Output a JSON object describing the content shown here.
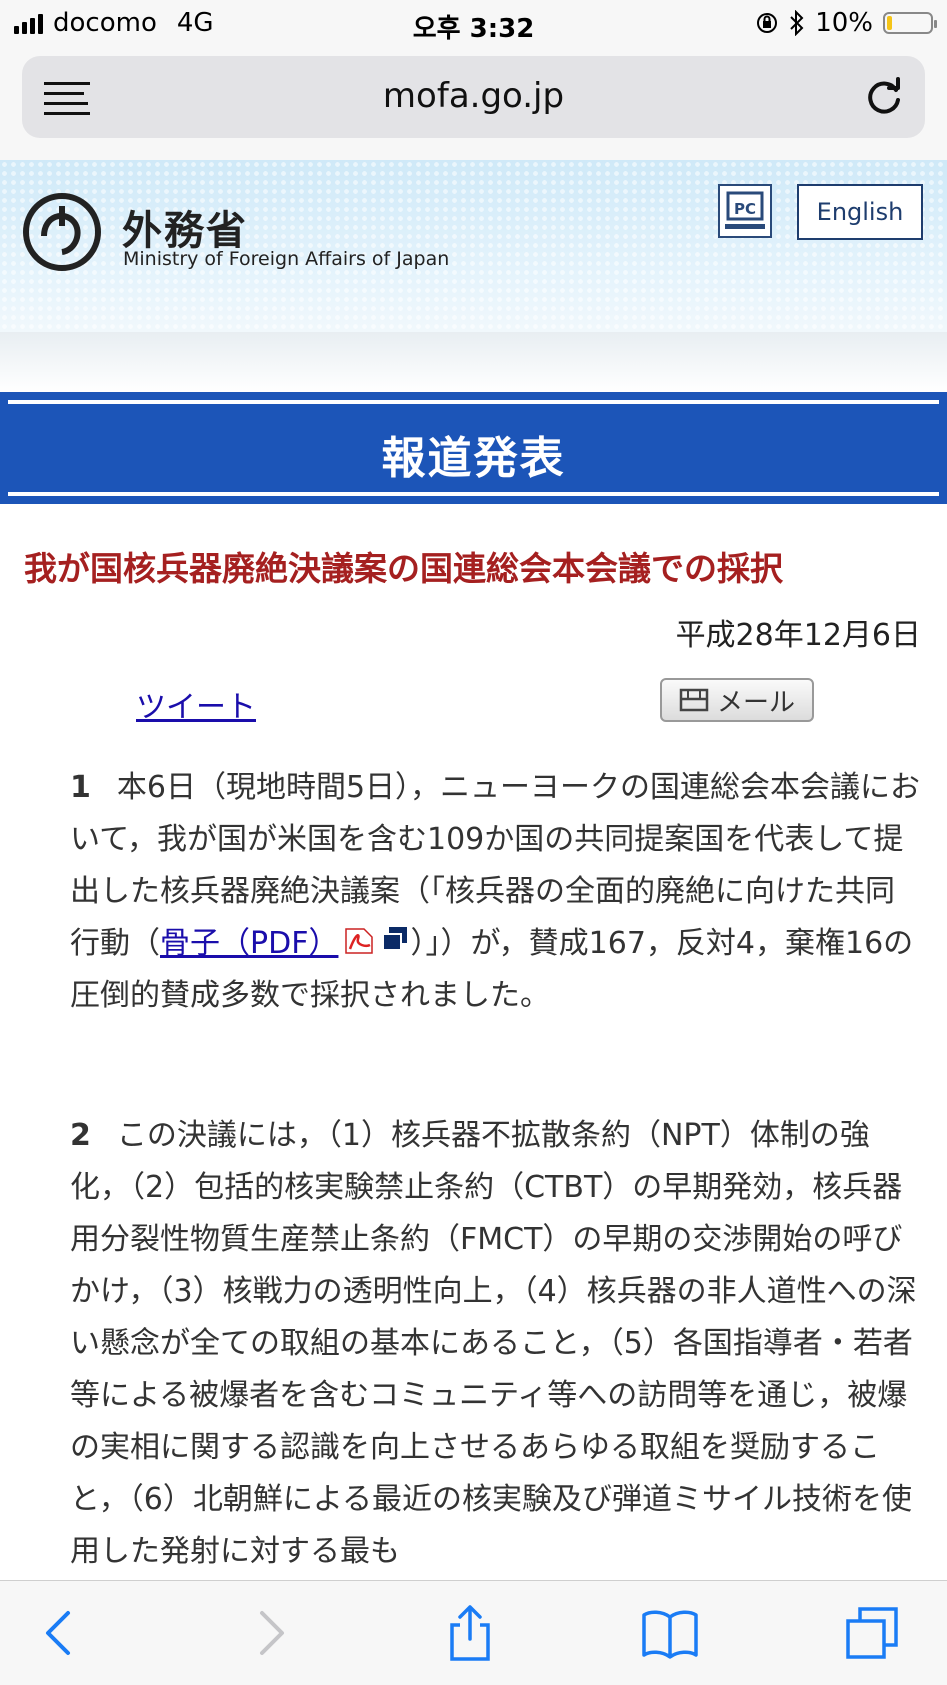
{
  "status": {
    "carrier": "docomo",
    "network": "4G",
    "time": "오후 3:32",
    "battery": "10%"
  },
  "browser": {
    "url": "mofa.go.jp"
  },
  "header": {
    "ministry_jp": "外務省",
    "ministry_en": "Ministry of Foreign Affairs of Japan",
    "pc_label": "PC",
    "english_label": "English"
  },
  "page": {
    "section_title": "報道発表",
    "headline": "我が国核兵器廃絶決議案の国連総会本会議での採択",
    "date": "平成28年12月6日",
    "tweet": "ツイート",
    "mail": "メール"
  },
  "body": {
    "p1_num": "1",
    "p1_a": "本6日（現地時間5日），ニューヨークの国連総会本会議において，我が国が米国を含む109か国の共同提案国を代表して提出した核兵器廃絶決議案（「核兵器の全面的廃絶に向けた共同行動（",
    "p1_link": "骨子（PDF）",
    "p1_b": "）」）が，賛成167，反対4，棄権16の圧倒的賛成多数で採択されました。",
    "p2_num": "2",
    "p2_text": "この決議には，（1）核兵器不拡散条約（NPT）体制の強化，（2）包括的核実験禁止条約（CTBT）の早期発効，核兵器用分裂性物質生産禁止条約（FMCT）の早期の交渉開始の呼びかけ，（3）核戦力の透明性向上，（4）核兵器の非人道性への深い懸念が全ての取組の基本にあること，（5）各国指導者・若者等による被爆者を含むコミュニティ等への訪問等を通じ，被爆の実相に関する認識を向上させるあらゆる取組を奨励すること，（6）北朝鮮による最近の核実験及び弾道ミサイル技術を使用した発射に対する最も"
  },
  "colors": {
    "title_band": "#1c55b8",
    "headline": "#a52020",
    "link": "#1a0dab",
    "ios_blue": "#1a7cf5"
  }
}
